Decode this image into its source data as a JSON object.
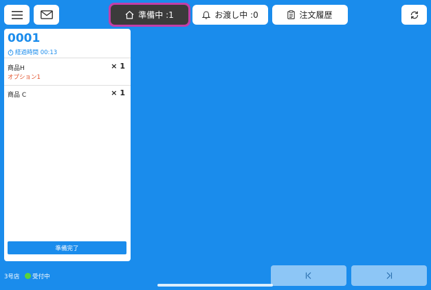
{
  "toolbar": {
    "menu_icon": "hamburger-menu-icon",
    "mail_icon": "envelope-icon",
    "refresh_icon": "refresh-icon",
    "tabs": [
      {
        "label": "準備中 :1",
        "icon": "home-icon",
        "active": true
      },
      {
        "label": "お渡し中 :0",
        "icon": "bell-icon",
        "active": false
      },
      {
        "label": "注文履歴",
        "icon": "clipboard-icon",
        "active": false
      }
    ],
    "active_tab_bg": "#3b3b3b",
    "active_tab_border": "#c23fa8"
  },
  "order": {
    "number": "0001",
    "elapsed_label": "経過時間 00:13",
    "items": [
      {
        "name": "商品H",
        "qty": "× 1",
        "option": "オプション1"
      },
      {
        "name": "商品 C",
        "qty": "× 1",
        "option": ""
      }
    ],
    "done_label": "準備完了"
  },
  "footer": {
    "store": "3号店",
    "status": "受付中",
    "status_color": "#5bd23a"
  },
  "pager": {
    "first_icon": "skip-to-first-icon",
    "last_icon": "skip-to-last-icon"
  },
  "colors": {
    "background": "#1a8cec",
    "accent": "#1a8cec",
    "option_text": "#e2512a"
  }
}
